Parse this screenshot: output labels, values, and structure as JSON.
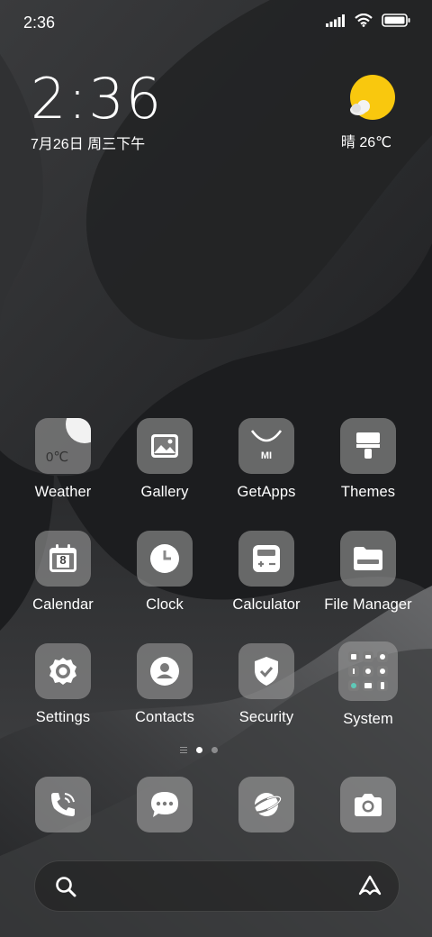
{
  "status_bar": {
    "time": "2:36",
    "icons": [
      "signal-icon",
      "wifi-icon",
      "battery-icon"
    ]
  },
  "clock_widget": {
    "time": "2:36",
    "date": "7月26日 周三下午"
  },
  "weather_widget": {
    "text": "晴 26℃",
    "icon": "sunny-cloud-icon"
  },
  "apps": [
    {
      "label": "Weather",
      "icon": "weather-icon",
      "tile_text": "0℃"
    },
    {
      "label": "Gallery",
      "icon": "gallery-icon"
    },
    {
      "label": "GetApps",
      "icon": "getapps-icon",
      "tile_text": "MI"
    },
    {
      "label": "Themes",
      "icon": "themes-icon"
    },
    {
      "label": "Calendar",
      "icon": "calendar-icon",
      "tile_text": "8"
    },
    {
      "label": "Clock",
      "icon": "clock-icon"
    },
    {
      "label": "Calculator",
      "icon": "calculator-icon"
    },
    {
      "label": "File Manager",
      "icon": "folder-icon"
    },
    {
      "label": "Settings",
      "icon": "gear-icon"
    },
    {
      "label": "Contacts",
      "icon": "contact-icon"
    },
    {
      "label": "Security",
      "icon": "shield-icon"
    },
    {
      "label": "System",
      "icon": "folder-grid-icon"
    }
  ],
  "page_indicator": {
    "pages": 2,
    "current": 1
  },
  "dock": [
    {
      "icon": "phone-icon"
    },
    {
      "icon": "messages-icon"
    },
    {
      "icon": "browser-icon"
    },
    {
      "icon": "camera-icon"
    }
  ],
  "search_bar": {
    "left_icon": "search-icon",
    "right_icon": "assistant-icon"
  },
  "colors": {
    "sun": "#f9c80e",
    "tile": "#8e8e8e",
    "background": "#1d1e20"
  }
}
